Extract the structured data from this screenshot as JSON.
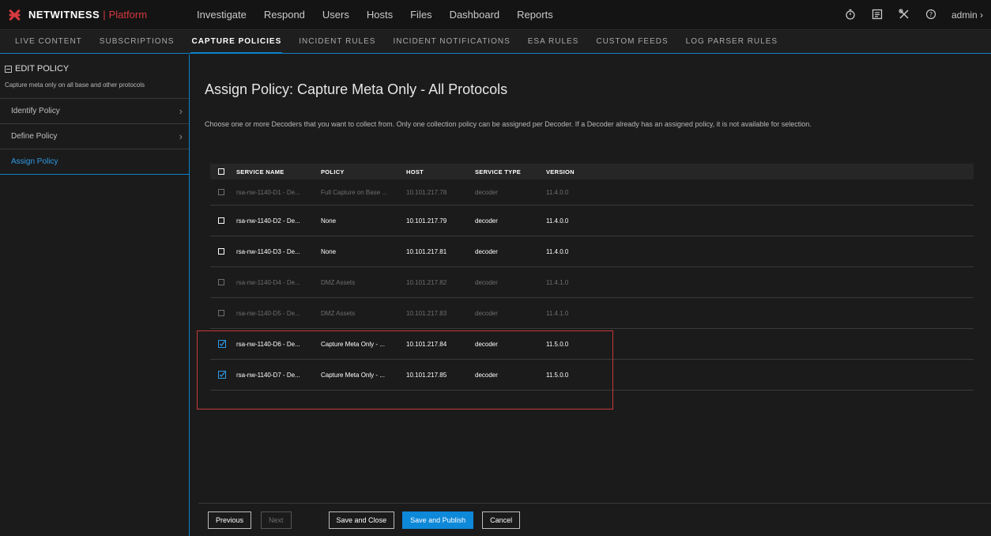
{
  "topnav": {
    "brand": "NETWITNESS",
    "sep": "|",
    "platform": "Platform",
    "items": [
      "Investigate",
      "Respond",
      "Users",
      "Hosts",
      "Files",
      "Dashboard",
      "Reports"
    ],
    "icons": [
      "stopwatch-icon",
      "notes-icon",
      "tools-icon",
      "help-icon"
    ],
    "user": "admin"
  },
  "subnav": {
    "tabs": [
      "LIVE CONTENT",
      "SUBSCRIPTIONS",
      "CAPTURE POLICIES",
      "INCIDENT RULES",
      "INCIDENT NOTIFICATIONS",
      "ESA RULES",
      "CUSTOM FEEDS",
      "LOG PARSER RULES"
    ],
    "active_index": 2
  },
  "leftpanel": {
    "title": "EDIT POLICY",
    "description": "Capture meta only on all base and other protocols",
    "steps": [
      "Identify Policy",
      "Define Policy",
      "Assign Policy"
    ],
    "active_step": 2
  },
  "main": {
    "title": "Assign Policy: Capture Meta Only - All Protocols",
    "description": "Choose one or more Decoders that you want to collect from. Only one collection policy can be assigned per Decoder. If a Decoder already has an assigned policy, it is not available for selection."
  },
  "table": {
    "columns": [
      "SERVICE NAME",
      "POLICY",
      "HOST",
      "SERVICE TYPE",
      "VERSION"
    ],
    "rows": [
      {
        "name": "rsa-nw-1140-D1 - De...",
        "policy": "Full Capture on Base ...",
        "host": "10.101.217.78",
        "type": "decoder",
        "version": "11.4.0.0",
        "disabled": true,
        "checked": false
      },
      {
        "name": "rsa-nw-1140-D2 - De...",
        "policy": "None",
        "host": "10.101.217.79",
        "type": "decoder",
        "version": "11.4.0.0",
        "disabled": false,
        "checked": false
      },
      {
        "name": "rsa-nw-1140-D3 - De...",
        "policy": "None",
        "host": "10.101.217.81",
        "type": "decoder",
        "version": "11.4.0.0",
        "disabled": false,
        "checked": false
      },
      {
        "name": "rsa-nw-1140-D4 - De...",
        "policy": "DMZ Assets",
        "host": "10.101.217.82",
        "type": "decoder",
        "version": "11.4.1.0",
        "disabled": true,
        "checked": false
      },
      {
        "name": "rsa-nw-1140-D5 - De...",
        "policy": "DMZ Assets",
        "host": "10.101.217.83",
        "type": "decoder",
        "version": "11.4.1.0",
        "disabled": true,
        "checked": false
      },
      {
        "name": "rsa-nw-1140-D6 - De...",
        "policy": "Capture Meta Only - ...",
        "host": "10.101.217.84",
        "type": "decoder",
        "version": "11.5.0.0",
        "disabled": false,
        "checked": true
      },
      {
        "name": "rsa-nw-1140-D7 - De...",
        "policy": "Capture Meta Only - ...",
        "host": "10.101.217.85",
        "type": "decoder",
        "version": "11.5.0.0",
        "disabled": false,
        "checked": true
      }
    ]
  },
  "footer": {
    "previous": "Previous",
    "next": "Next",
    "save_close": "Save and Close",
    "save_publish": "Save and Publish",
    "cancel": "Cancel"
  },
  "colors": {
    "accent": "#0e82c9",
    "brand_red": "#d8393f",
    "highlight": "#c83a3a"
  }
}
